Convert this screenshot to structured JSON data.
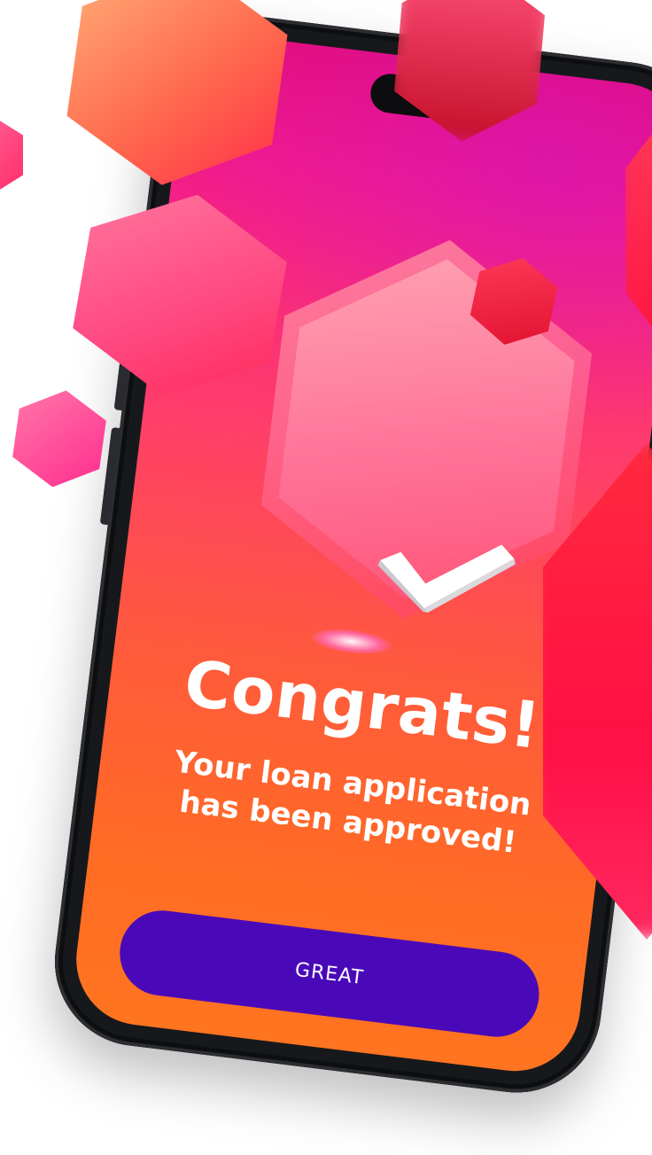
{
  "screen": {
    "title": "Congrats!",
    "message_line1": "Your loan application",
    "message_line2": "has been approved!",
    "button_label": "GREAT"
  },
  "colors": {
    "button": "#4a09b8",
    "gradient_top": "#e30e7b",
    "gradient_bottom": "#ff7420",
    "text": "#ffffff"
  },
  "icons": {
    "success": "checkmark-icon"
  }
}
